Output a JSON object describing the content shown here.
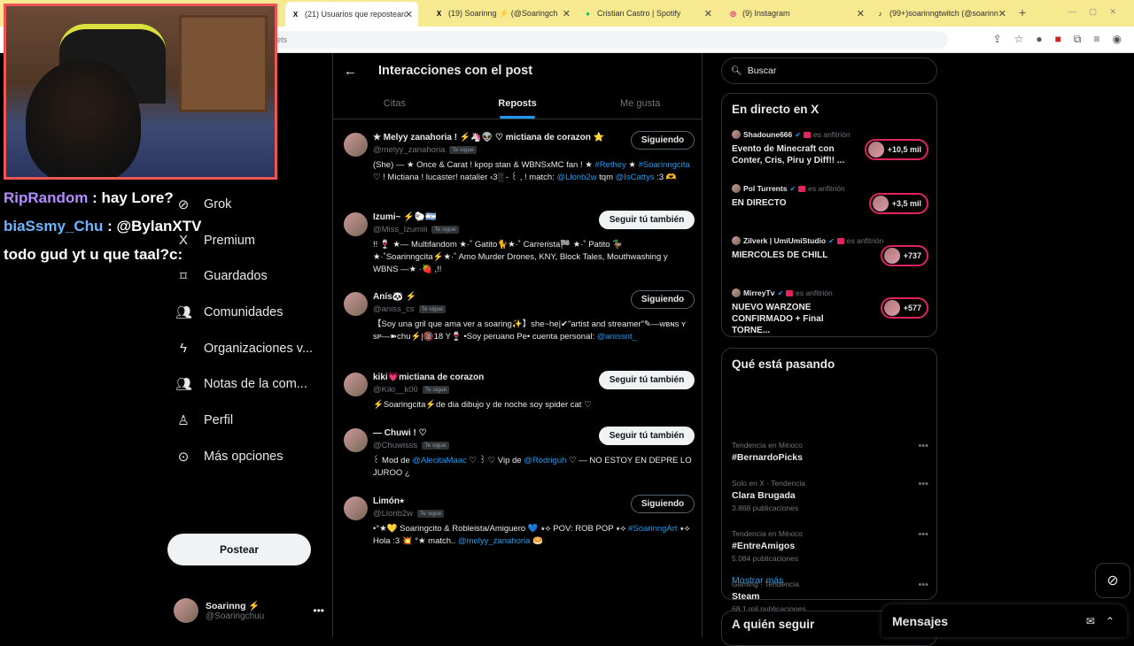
{
  "browser": {
    "tabs": [
      {
        "label": "(21) Usuarios que repostearon",
        "icon": "x-logo-icon",
        "icon_color": "#000000",
        "active": true
      },
      {
        "label": "(19) Soarinng ⚡ (@Soaringch",
        "icon": "x-logo-icon",
        "icon_color": "#000000",
        "active": false
      },
      {
        "label": "Cristian Castro | Spotify",
        "icon": "spotify-icon",
        "icon_color": "#1db954",
        "active": false
      },
      {
        "label": "(9) Instagram",
        "icon": "instagram-icon",
        "icon_color": "#d62976",
        "active": false
      },
      {
        "label": "(99+)soarinngtwitch (@soarinn",
        "icon": "tiktok-icon",
        "icon_color": "#000000",
        "active": false
      }
    ],
    "url": "ets"
  },
  "overlay": {
    "chat": [
      {
        "user": "RipRandom",
        "message": ": hay Lore?",
        "user_color": "#b48cff"
      },
      {
        "user": "biaSsmy_Chu",
        "message": ": @BylanXTV",
        "user_color": "#6db6ff"
      },
      {
        "user": "",
        "message": "todo gud yt u que taal?c:",
        "user_color": "#ffffff"
      }
    ]
  },
  "nav": {
    "items": [
      {
        "label": "Mensajes",
        "icon": "envelope-icon"
      },
      {
        "label": "Grok",
        "icon": "grok-icon"
      },
      {
        "label": "Premium",
        "icon": "x-logo-icon"
      },
      {
        "label": "Guardados",
        "icon": "bookmark-icon"
      },
      {
        "label": "Comunidades",
        "icon": "communities-icon"
      },
      {
        "label": "Organizaciones v...",
        "icon": "lightning-icon"
      },
      {
        "label": "Notas de la com...",
        "icon": "community-notes-icon"
      },
      {
        "label": "Perfil",
        "icon": "person-icon"
      },
      {
        "label": "Más opciones",
        "icon": "more-circle-icon"
      }
    ],
    "post_button": "Postear",
    "account": {
      "name": "Soarinng ⚡",
      "handle": "@Soaringchuu"
    }
  },
  "main": {
    "title": "Interacciones con el post",
    "tabs": [
      "Citas",
      "Reposts",
      "Me gusta"
    ],
    "active_tab": "Reposts",
    "users": [
      {
        "name": "★ Melyy zanahoria ! ⚡🦄👽 ♡ mictiana de corazon ⭐",
        "handle": "@melyy_zanahoria",
        "follows_you": "Te sigue",
        "button": "Siguiendo",
        "bio": [
          "(She) — ★ Once & Carat ! kpop stan & WBNSxMC fan ! ★ ",
          {
            "link": "#Rethey"
          },
          " ★ ",
          {
            "link": "#Soarinngcita"
          },
          " ♡ ! Mictiana ! lucaster! natalier ‹3░ - ꒰ , ! match: ",
          {
            "link": "@Llonb2w"
          },
          " tqm ",
          {
            "link": "@IsCattys"
          },
          " :3 🫶"
        ]
      },
      {
        "name": "Izumi~ ⚡🐑🇦🇷",
        "handle": "@Miss_Izumiii",
        "follows_you": "Te sigue",
        "button": "Seguir tú también",
        "bio": [
          "!! 🍷 ★— Multifandom ★·˚ Gatito🐈★·˚ Carrerista🏁 ★·˚ Patito 🦆 ★·˚Soarinngcita⚡★·˚ Amo Murder Drones, KNY, Block Tales, Mouthwashing y WBNS —★ ·🍓 ,!!"
        ]
      },
      {
        "name": "Anís🐼 ⚡",
        "handle": "@aniss_cs",
        "follows_you": "Te sigue",
        "button": "Siguiendo",
        "bio": [
          "【Soy una gril que ama ver a soaring✨】she~he|✔\"artist and streamer\"✎—ᴡʙɴs ʏ sᴘ—➽chu⚡|🔞18 Y🍷 •Soy peruano Pe• cuenta personal: ",
          {
            "link": "@anissnt_"
          }
        ]
      },
      {
        "name": "kiki💗mictiana de corazon",
        "handle": "@Kiki__k00",
        "follows_you": "Te sigue",
        "button": "Seguir tú también",
        "bio": [
          "⚡Soaringcita⚡de dia dibujo y de noche soy spider cat ♡"
        ]
      },
      {
        "name": "— Chuwi ! ♡",
        "handle": "@Chuwisss",
        "follows_you": "Te sigue",
        "button": "Seguir tú también",
        "bio": [
          "           ꒰ Mod de ",
          {
            "link": "@AlecitaMaac"
          },
          " ♡ ꒱          ♡ Vip de ",
          {
            "link": "@Rodriguh"
          },
          " ♡ — NO ESTOY EN DEPRE LO JUROO      ¿"
        ]
      },
      {
        "name": "Limón⭑",
        "handle": "@Llonb2w",
        "follows_you": "Te sigue",
        "button": "Siguiendo",
        "bio": [
          "•°★💛 Soaringcito & Robleista/Amiguero 💙 ⭑⟡ POV: ROB POP ⭑⟡ ",
          {
            "link": "#SoarinngArt"
          },
          " ⭑⟡ Hola :3 💥 °★ match.. ",
          {
            "link": "@melyy_zanahoria"
          },
          " 🥯"
        ]
      }
    ]
  },
  "sidebar": {
    "search_placeholder": "Buscar",
    "live": {
      "title": "En directo en X",
      "host_suffix": "es anfitrión",
      "items": [
        {
          "host": "Shadoune666",
          "event": "Evento de Minecraft con Conter, Cris, Piru y Diff!! ...",
          "count": "+10,5 mil"
        },
        {
          "host": "Pol Turrents",
          "event": "EN DIRECTO",
          "count": "+3,5 mil"
        },
        {
          "host": "Zilverk | UmiUmiStudio",
          "event": "MIERCOLES DE CHILL",
          "count": "+737"
        },
        {
          "host": "MirreyTv",
          "event": "NUEVO WARZONE CONFIRMADO + Final TORNE...",
          "count": "+577"
        }
      ]
    },
    "trends": {
      "title": "Qué está pasando",
      "items": [
        {
          "context": "Tendencia en México",
          "name": "#BernardoPicks",
          "count": ""
        },
        {
          "context": "Solo en X · Tendencia",
          "name": "Clara Brugada",
          "count": "3.868 publicaciones"
        },
        {
          "context": "Tendencia en México",
          "name": "#EntreAmigos",
          "count": "5.084 publicaciones"
        },
        {
          "context": "Gaming · Tendencia",
          "name": "Steam",
          "count": "68,1 mil publicaciones"
        }
      ],
      "show_more": "Mostrar más"
    },
    "who_to_follow": "A quién seguir"
  },
  "messages_drawer": {
    "label": "Mensajes"
  },
  "colors": {
    "accent": "#1d9bf0",
    "live_red": "#e0245e",
    "tabbar": "#f7e98f"
  }
}
